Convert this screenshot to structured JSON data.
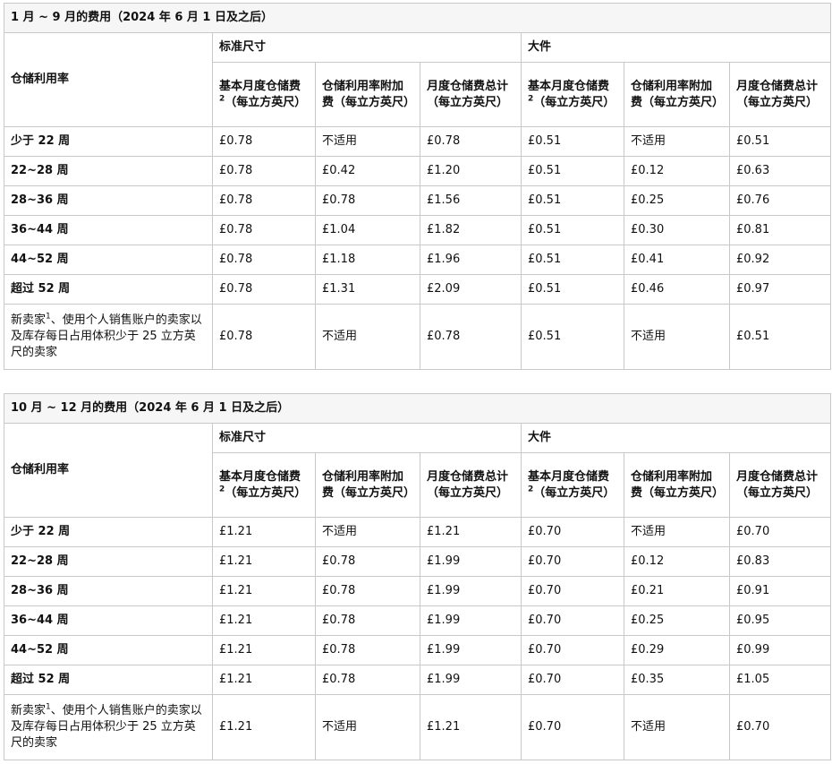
{
  "groups": {
    "standard": "标准尺寸",
    "large": "大件"
  },
  "columns": {
    "row_header": "仓储利用率",
    "base_fee_label": "基本月度仓储费",
    "base_fee_sup": "2",
    "base_fee_unit": "（每立方英尺）",
    "surcharge": "仓储利用率附加费（每立方英尺）",
    "total": "月度仓储费总计（每立方英尺）"
  },
  "new_seller": {
    "label_a": "新卖家",
    "sup": "1",
    "label_b": "、使用个人销售账户的卖家以及库存每日占用体积少于 25 立方英尺的卖家"
  },
  "jan_sep": {
    "caption": "1 月 ~ 9 月的费用（2024 年 6 月 1 日及之后）",
    "rows": [
      {
        "label": "少于 22 周",
        "v": [
          "£0.78",
          "不适用",
          "£0.78",
          "£0.51",
          "不适用",
          "£0.51"
        ]
      },
      {
        "label": "22~28 周",
        "v": [
          "£0.78",
          "£0.42",
          "£1.20",
          "£0.51",
          "£0.12",
          "£0.63"
        ]
      },
      {
        "label": "28~36 周",
        "v": [
          "£0.78",
          "£0.78",
          "£1.56",
          "£0.51",
          "£0.25",
          "£0.76"
        ]
      },
      {
        "label": "36~44 周",
        "v": [
          "£0.78",
          "£1.04",
          "£1.82",
          "£0.51",
          "£0.30",
          "£0.81"
        ]
      },
      {
        "label": "44~52 周",
        "v": [
          "£0.78",
          "£1.18",
          "£1.96",
          "£0.51",
          "£0.41",
          "£0.92"
        ]
      },
      {
        "label": "超过 52 周",
        "v": [
          "£0.78",
          "£1.31",
          "£2.09",
          "£0.51",
          "£0.46",
          "£0.97"
        ]
      }
    ],
    "new_seller_values": [
      "£0.78",
      "不适用",
      "£0.78",
      "£0.51",
      "不适用",
      "£0.51"
    ]
  },
  "oct_dec": {
    "caption": "10 月 ~ 12 月的费用（2024 年 6 月 1 日及之后）",
    "rows": [
      {
        "label": "少于 22 周",
        "v": [
          "£1.21",
          "不适用",
          "£1.21",
          "£0.70",
          "不适用",
          "£0.70"
        ]
      },
      {
        "label": "22~28 周",
        "v": [
          "£1.21",
          "£0.78",
          "£1.99",
          "£0.70",
          "£0.12",
          "£0.83"
        ]
      },
      {
        "label": "28~36 周",
        "v": [
          "£1.21",
          "£0.78",
          "£1.99",
          "£0.70",
          "£0.21",
          "£0.91"
        ]
      },
      {
        "label": "36~44 周",
        "v": [
          "£1.21",
          "£0.78",
          "£1.99",
          "£0.70",
          "£0.25",
          "£0.95"
        ]
      },
      {
        "label": "44~52 周",
        "v": [
          "£1.21",
          "£0.78",
          "£1.99",
          "£0.70",
          "£0.29",
          "£0.99"
        ]
      },
      {
        "label": "超过 52 周",
        "v": [
          "£1.21",
          "£0.78",
          "£1.99",
          "£0.70",
          "£0.35",
          "£1.05"
        ]
      }
    ],
    "new_seller_values": [
      "£1.21",
      "不适用",
      "£1.21",
      "£0.70",
      "不适用",
      "£0.70"
    ]
  }
}
